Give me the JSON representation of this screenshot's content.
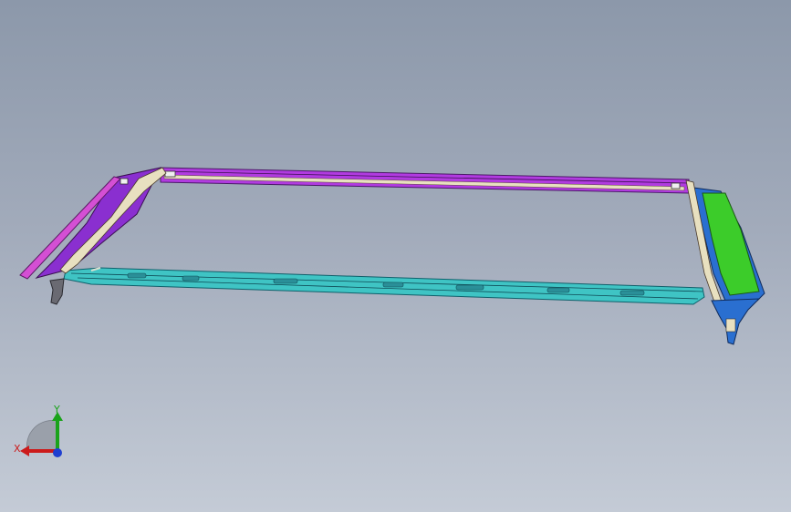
{
  "viewport": {
    "background_top": "#8c98aa",
    "background_bottom": "#c4cbd6"
  },
  "model": {
    "parts": [
      {
        "name": "roof-rail-front",
        "color": "#b13be0"
      },
      {
        "name": "a-pillar-left",
        "color": "#8a2fd0"
      },
      {
        "name": "a-pillar-left-flange",
        "color": "#d44fd4"
      },
      {
        "name": "cowl-lower-rail",
        "color": "#3fc4c4"
      },
      {
        "name": "a-pillar-right",
        "color": "#3ccc2a"
      },
      {
        "name": "a-pillar-right-outer",
        "color": "#2a6fd0"
      }
    ]
  },
  "triad": {
    "x_label": "X",
    "y_label": "Y",
    "x_color": "#cc1b1b",
    "y_color": "#1aa31a",
    "z_color": "#1f3fd0"
  }
}
